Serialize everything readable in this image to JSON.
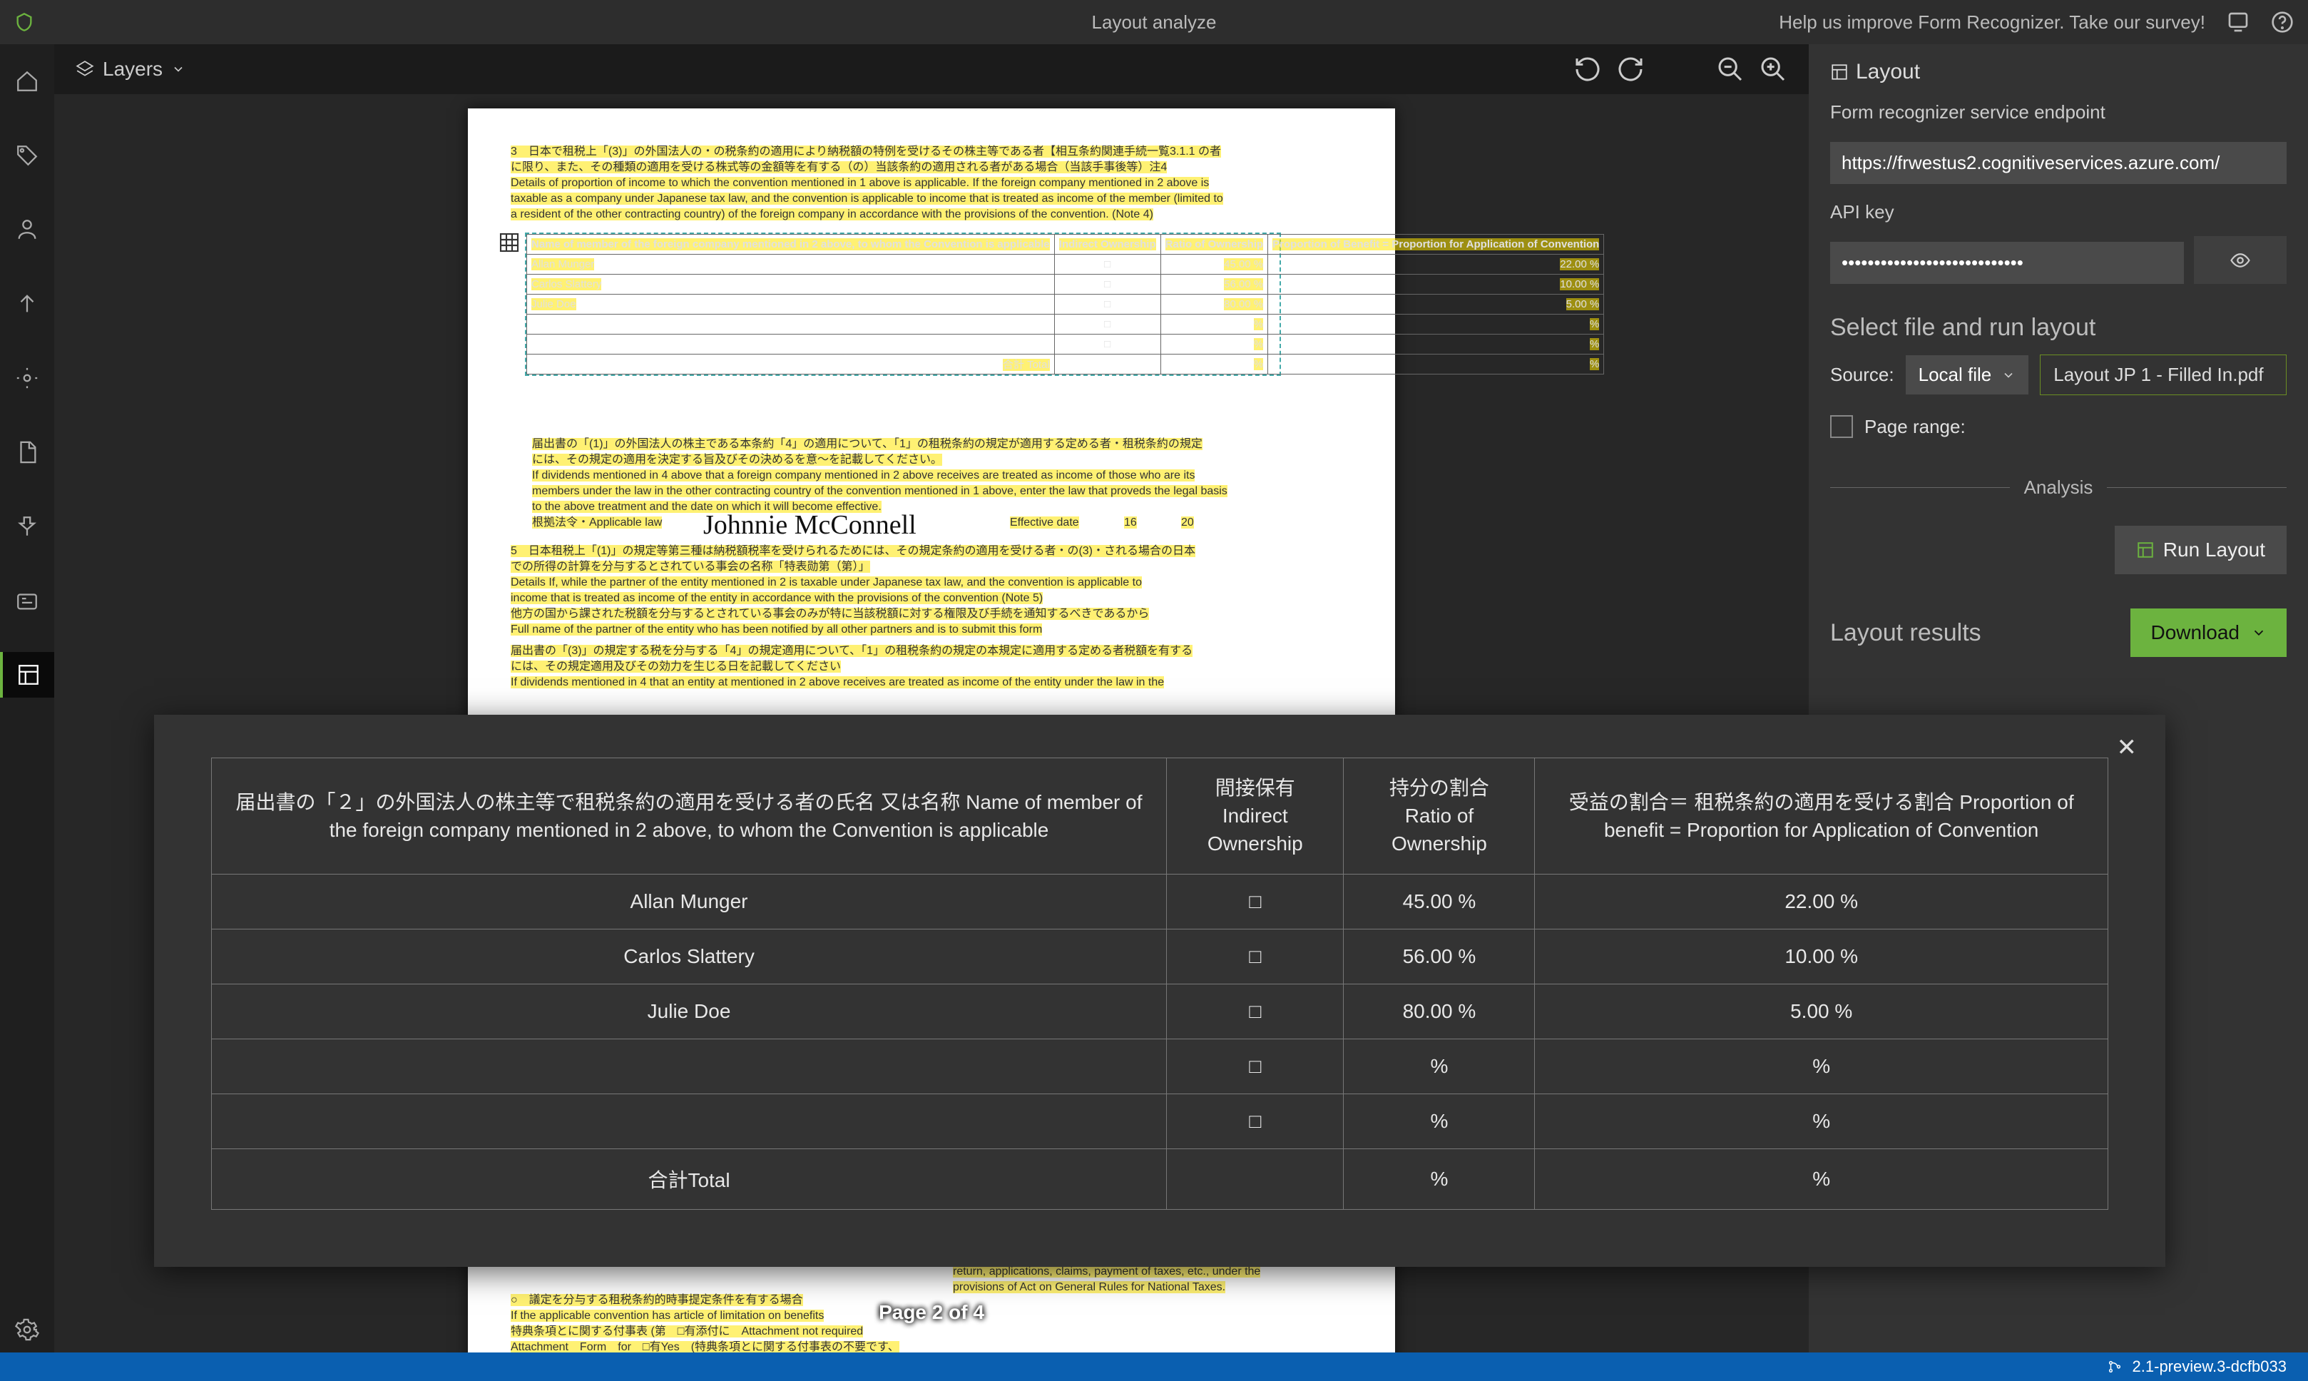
{
  "titlebar": {
    "app_title": "Layout analyze",
    "survey_text": "Help us improve Form Recognizer. Take our survey!"
  },
  "canvas": {
    "layers_label": "Layers",
    "page_indicator": "Page 2 of 4"
  },
  "doc_preview": {
    "signature_text": "Johnnie McConnell",
    "effective_date_label": "Effective date",
    "effective_day": "16",
    "effective_month": "20",
    "table": {
      "headers": {
        "name": "Name of member of the foreign company mentioned in 2 above, to whom the Convention is applicable",
        "indirect": "Indirect Ownership",
        "ratio": "Ratio of Ownership",
        "benefit": "Proportion of Benefit = Proportion for Application of Convention"
      },
      "rows": [
        {
          "name": "Allan Munger",
          "indirect": "□",
          "ratio": "45.00 %",
          "benefit": "22.00 %"
        },
        {
          "name": "Carlos Slattery",
          "indirect": "□",
          "ratio": "56.00 %",
          "benefit": "10.00 %"
        },
        {
          "name": "Julie Doe",
          "indirect": "□",
          "ratio": "80.00 %",
          "benefit": "5.00 %"
        },
        {
          "name": "",
          "indirect": "□",
          "ratio": "%",
          "benefit": "%"
        },
        {
          "name": "",
          "indirect": "□",
          "ratio": "%",
          "benefit": "%"
        }
      ],
      "total_label": "合計 Total",
      "total_ratio": "%",
      "total_benefit": "%"
    }
  },
  "right_panel": {
    "heading": "Layout",
    "endpoint_label": "Form recognizer service endpoint",
    "endpoint_value": "https://frwestus2.cognitiveservices.azure.com/",
    "apikey_label": "API key",
    "apikey_masked": "••••••••••••••••••••••••••••",
    "select_file_heading": "Select file and run layout",
    "source_label": "Source:",
    "source_value": "Local file",
    "file_name": "Layout JP 1 - Filled In.pdf",
    "page_range_label": "Page range:",
    "analysis_divider": "Analysis",
    "run_label": "Run Layout",
    "results_heading": "Layout results",
    "download_label": "Download"
  },
  "statusbar": {
    "version": "2.1-preview.3-dcfb033"
  },
  "overlay_table": {
    "headers": {
      "name": "届出書の「２」の外国法人の株主等で租税条約の適用を受ける者の氏名 又は名称 Name of member of the foreign company mentioned in 2 above, to whom the Convention is applicable",
      "indirect": "間接保有 Indirect Ownership",
      "ratio": "持分の割合 Ratio of Ownership",
      "benefit": "受益の割合＝ 租税条約の適用を受ける割合 Proportion of benefit = Proportion for Application of Convention"
    },
    "rows": [
      {
        "name": "Allan Munger",
        "indirect": "□",
        "ratio": "45.00 %",
        "benefit": "22.00 %"
      },
      {
        "name": "Carlos Slattery",
        "indirect": "□",
        "ratio": "56.00 %",
        "benefit": "10.00 %"
      },
      {
        "name": "Julie Doe",
        "indirect": "□",
        "ratio": "80.00 %",
        "benefit": "5.00 %"
      },
      {
        "name": "",
        "indirect": "□",
        "ratio": "%",
        "benefit": "%"
      },
      {
        "name": "",
        "indirect": "□",
        "ratio": "%",
        "benefit": "%"
      },
      {
        "name": "合計Total",
        "indirect": "",
        "ratio": "%",
        "benefit": "%"
      }
    ]
  }
}
